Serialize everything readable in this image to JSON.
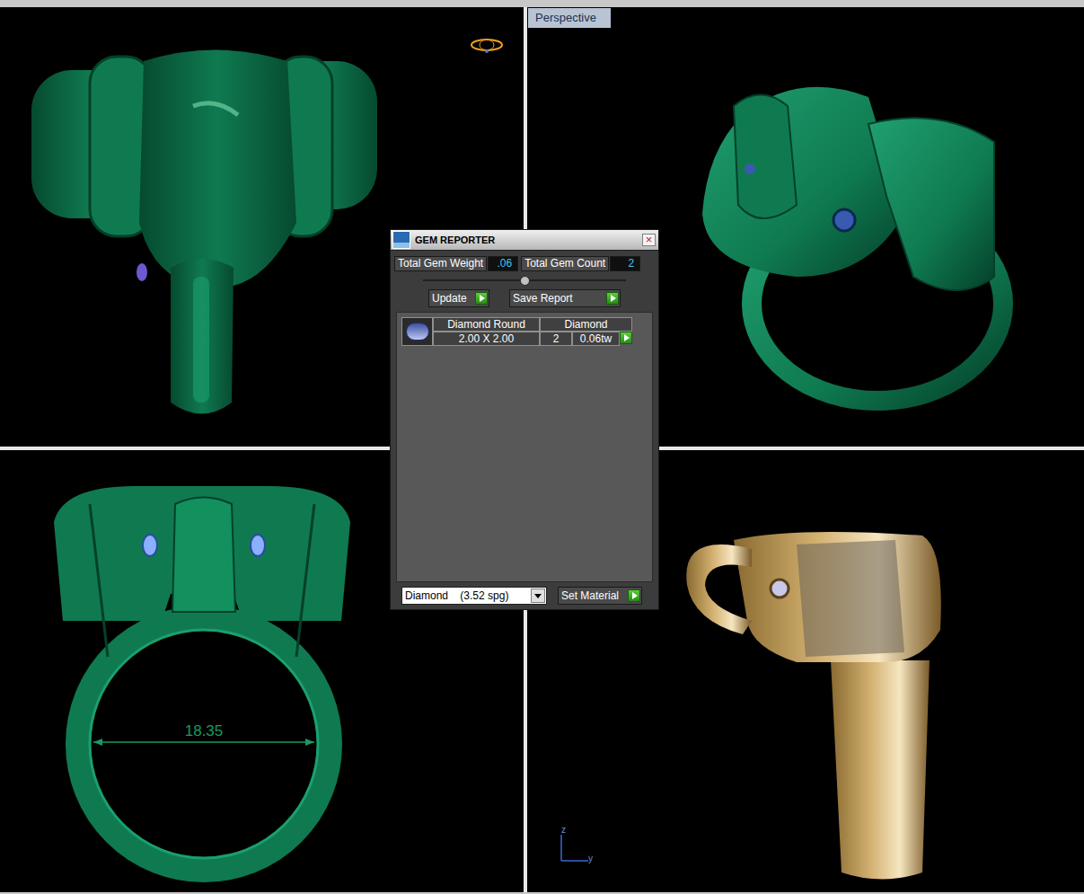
{
  "viewports": {
    "top_left": {
      "color": "#0f7a50"
    },
    "top_right": {
      "label": "Perspective",
      "color": "#0f7a50"
    },
    "bottom_left": {
      "color": "#0f7a50",
      "dimension": "18.35"
    },
    "bottom_right": {
      "color": "#d2b070",
      "axis_labels": [
        "z",
        "y"
      ]
    }
  },
  "gem_reporter": {
    "title": "GEM REPORTER",
    "close": "×",
    "stats": [
      {
        "label": "Total Gem Weight",
        "value": ".06"
      },
      {
        "label": "Total Gem Count",
        "value": "2"
      }
    ],
    "buttons": [
      "Update",
      "Save Report"
    ],
    "gems": [
      {
        "shape": "Diamond Round",
        "size": "2.00 X 2.00",
        "material": "Diamond",
        "count": "2",
        "weight": "0.06tw"
      }
    ],
    "material_select": "Diamond    (3.52 spg)",
    "set_material": "Set Material"
  }
}
